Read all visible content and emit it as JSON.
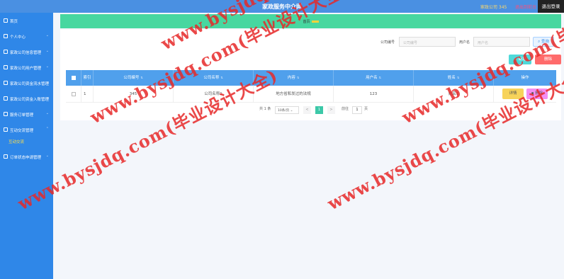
{
  "header": {
    "title": "家政服务中介网",
    "user_label": "家政公司 345",
    "back_label": "退出到前台",
    "logout_label": "退出登录"
  },
  "sidebar": {
    "items": [
      {
        "label": "首页",
        "has_chevron": false
      },
      {
        "label": "个人中心",
        "has_chevron": true
      },
      {
        "label": "家政公司信息管理",
        "has_chevron": true
      },
      {
        "label": "家政公司用户管理",
        "has_chevron": true
      },
      {
        "label": "家政公司资金流水管理",
        "has_chevron": true
      },
      {
        "label": "家政公司资金入账管理",
        "has_chevron": true
      },
      {
        "label": "服务订单管理",
        "has_chevron": true
      },
      {
        "label": "互动交流管理",
        "has_chevron": true
      },
      {
        "label": "订单状态申请管理",
        "has_chevron": true
      }
    ],
    "active_sub": "互动交流"
  },
  "breadcrumb": {
    "home": "首页"
  },
  "search": {
    "company_label": "公司编号",
    "company_placeholder": "公司编号",
    "user_label": "用户名",
    "user_placeholder": "用户名",
    "search_button": "查询"
  },
  "toolbar": {
    "add_label": "+ 新增",
    "delete_label": "删除"
  },
  "table": {
    "columns": [
      "索引",
      "公司编号",
      "公司名称",
      "内容",
      "用户名",
      "姓名",
      "操作"
    ],
    "rows": [
      {
        "index": "1",
        "company_id": "345",
        "company_name": "公司名称1",
        "content": "地方省和发过的法规",
        "username": "123",
        "name": "姓名1"
      }
    ],
    "detail_label": "详情",
    "row_delete_label": "删除"
  },
  "pagination": {
    "total": "共 1 条",
    "page_size": "10条/页",
    "prev": "<",
    "current": "1",
    "next": ">",
    "goto_label": "前往",
    "goto_value": "1",
    "page_unit": "页"
  },
  "watermark": {
    "text": "www.bysjdq.com(毕业设计大全)"
  },
  "colors": {
    "topbar": "#4a90e2",
    "sidebar": "#2f87e8",
    "breadcrumb": "#47d7a0",
    "table_header": "#50a0ec",
    "watermark": "#e62828"
  }
}
